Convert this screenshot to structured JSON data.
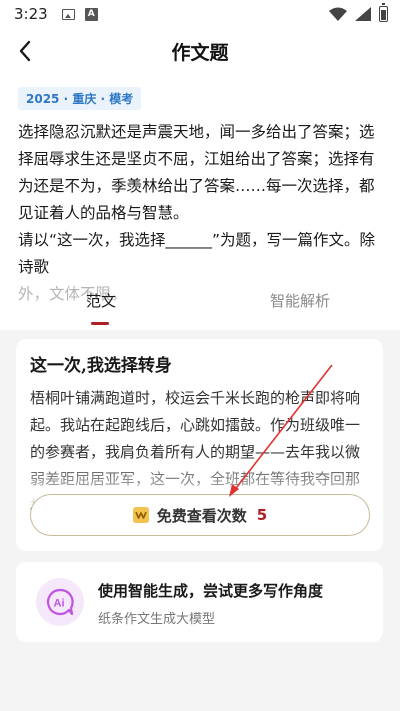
{
  "status_bar": {
    "time": "3:23"
  },
  "header": {
    "title": "作文题"
  },
  "tag": "2025 · 重庆 · 模考",
  "prompt": {
    "paragraph1": "选择隐忍沉默还是声震天地，闻一多给出了答案；选择屈辱求生还是坚贞不屈，江姐给出了答案；选择有为还是不为，季羡林给出了答案……每一次选择，都见证着人的品格与智慧。",
    "paragraph2_visible": "请以“这一次，我选择______”为题，写一篇作文。除诗歌",
    "paragraph2_faded": "外，文体不限。"
  },
  "tabs": [
    {
      "label": "范文",
      "active": true
    },
    {
      "label": "智能解析",
      "active": false
    }
  ],
  "essay": {
    "title": "这一次,我选择转身",
    "body": "梧桐叶铺满跑道时，校运会千米长跑的枪声即将响起。我站在起跑线后，心跳如擂鼓。作为班级唯一的参赛者，我肩负着所有人的期望——去年我以微弱差距屈居亚军，这一次，全班都在等待我夺回那枚",
    "view_button": {
      "label": "免费查看次数",
      "count": "5"
    }
  },
  "ai_card": {
    "title": "使用智能生成，尝试更多写作角度",
    "subtitle": "纸条作文生成大模型",
    "icon_text": "Ai"
  },
  "colors": {
    "accent_red": "#b01f24",
    "tag_bg": "#eaf3fb",
    "tag_text": "#2f78c4",
    "annotation_red": "#e0332f"
  }
}
